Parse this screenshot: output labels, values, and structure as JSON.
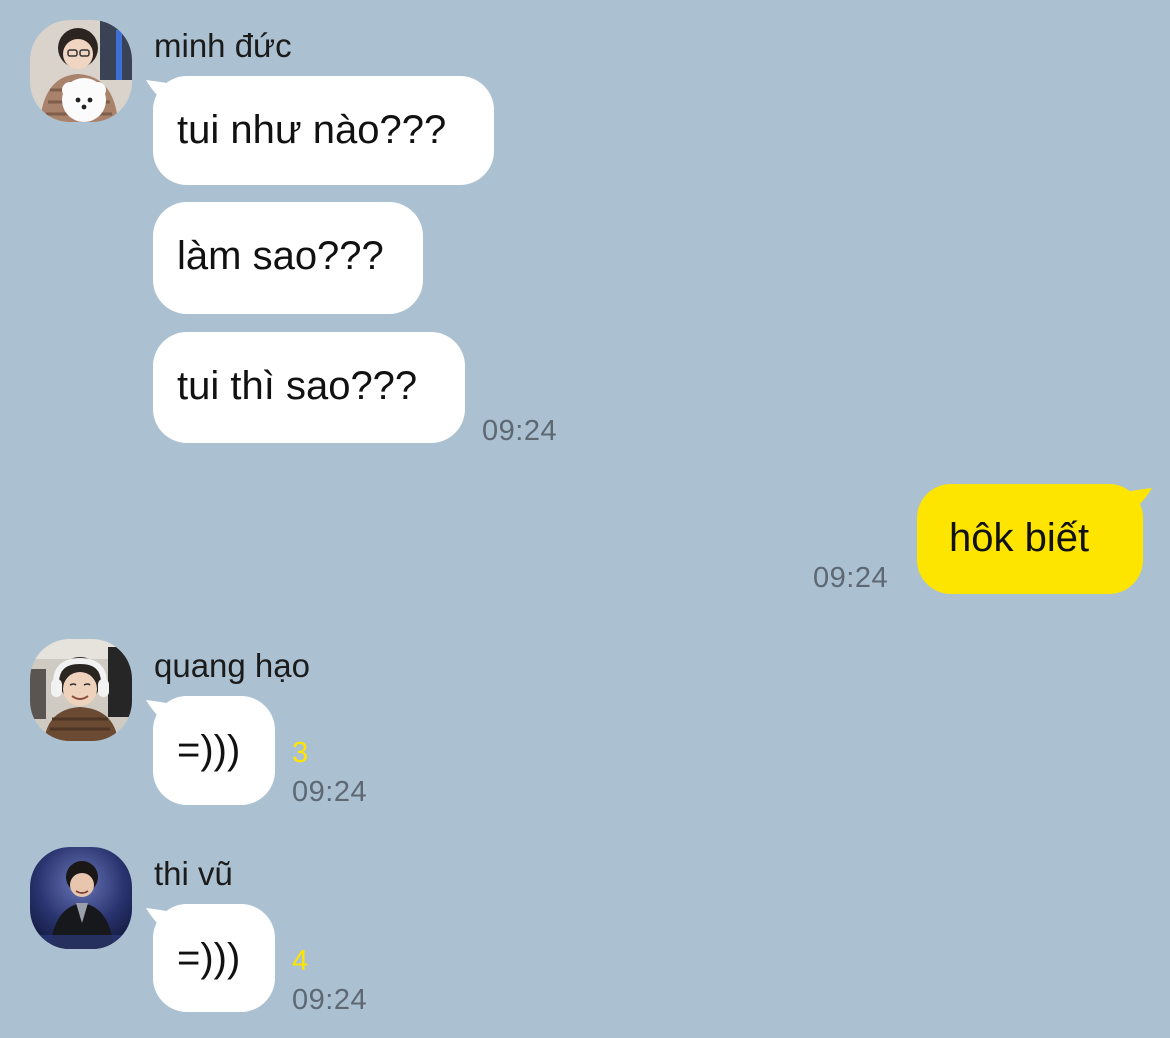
{
  "messages": [
    {
      "sender": "minh đức",
      "avatar": "user-photo-with-white-dog",
      "bubbles": [
        "tui như nào???",
        "làm sao???",
        "tui thì sao???"
      ],
      "time": "09:24"
    },
    {
      "sender": "me",
      "bubbles": [
        "hôk biết"
      ],
      "time": "09:24"
    },
    {
      "sender": "quang hạo",
      "avatar": "user-photo-with-headphones",
      "bubbles": [
        "=)))"
      ],
      "unread": "3",
      "time": "09:24"
    },
    {
      "sender": "thi vũ",
      "avatar": "user-photo-on-stage",
      "bubbles": [
        "=)))"
      ],
      "unread": "4",
      "time": "09:24"
    }
  ],
  "colors": {
    "background": "#abc1d1",
    "incoming_bubble": "#ffffff",
    "outgoing_bubble": "#fee500",
    "unread_count": "#fee500",
    "timestamp": "#5d6873"
  }
}
